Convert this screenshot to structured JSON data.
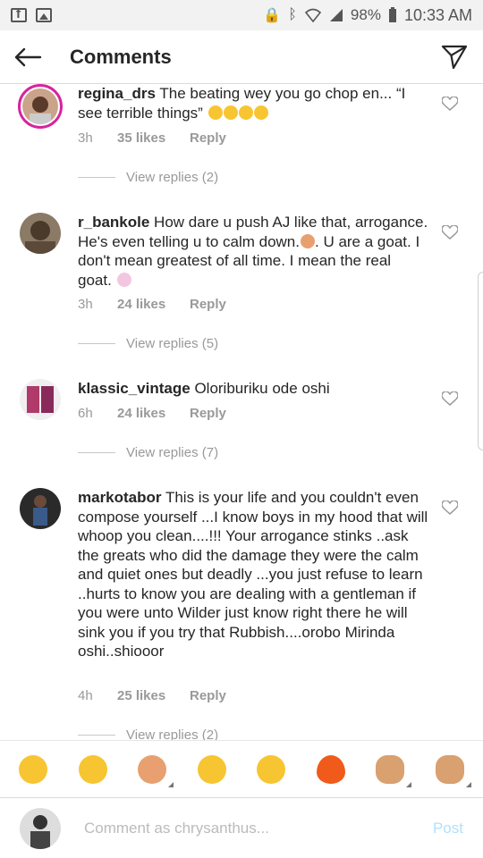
{
  "status_bar": {
    "left_icons": [
      "facebook-icon",
      "gallery-icon"
    ],
    "battery": "98%",
    "time": "10:33 AM"
  },
  "header": {
    "title": "Comments"
  },
  "comments": [
    {
      "username": "regina_drs",
      "text": "The beating wey you go chop en... “I see terrible things”",
      "trailing_emoji": [
        "grinning-sweat",
        "joy",
        "joy",
        "joy"
      ],
      "time": "3h",
      "likes": "35 likes",
      "reply": "Reply",
      "view_replies": "View replies (2)"
    },
    {
      "username": "r_bankole",
      "text_part1": "How dare u push AJ like that, arrogance. He's even telling u to calm down.",
      "text_part2": ". U are a goat. I don't mean greatest of all time. I mean the real goat.",
      "time": "3h",
      "likes": "24 likes",
      "reply": "Reply",
      "view_replies": "View replies (5)"
    },
    {
      "username": "klassic_vintage",
      "text": "Oloriburiku ode oshi",
      "time": "6h",
      "likes": "24 likes",
      "reply": "Reply",
      "view_replies": "View replies (7)"
    },
    {
      "username": "markotabor",
      "text": "This is your life and you couldn't even compose yourself ...I know boys in my hood that will whoop you clean....!!! Your arrogance stinks ..ask the greats who did the damage they were the calm and quiet ones but deadly ...you just refuse to learn ..hurts to know you are dealing with a gentleman if you were unto Wilder just know right there he will sink you if you try that Rubbish....orobo Mirinda oshi..shiooor",
      "time": "4h",
      "likes": "25 likes",
      "reply": "Reply",
      "view_replies": "View replies (2)"
    }
  ],
  "emoji_bar": [
    {
      "name": "rofl-emoji",
      "variants": false
    },
    {
      "name": "joy-emoji",
      "variants": false
    },
    {
      "name": "person-raising-hands-emoji",
      "variants": true
    },
    {
      "name": "grinning-emoji",
      "variants": false
    },
    {
      "name": "eye-roll-emoji",
      "variants": false
    },
    {
      "name": "fire-emoji",
      "variants": false
    },
    {
      "name": "pointing-hand-emoji",
      "variants": true
    },
    {
      "name": "ok-hand-emoji",
      "variants": true
    }
  ],
  "composer": {
    "placeholder": "Comment as chrysanthus...",
    "post_label": "Post"
  },
  "colors": {
    "text": "#262626",
    "muted": "#999999",
    "post_disabled": "#b2dffc",
    "story_ring": "#d6249f"
  }
}
